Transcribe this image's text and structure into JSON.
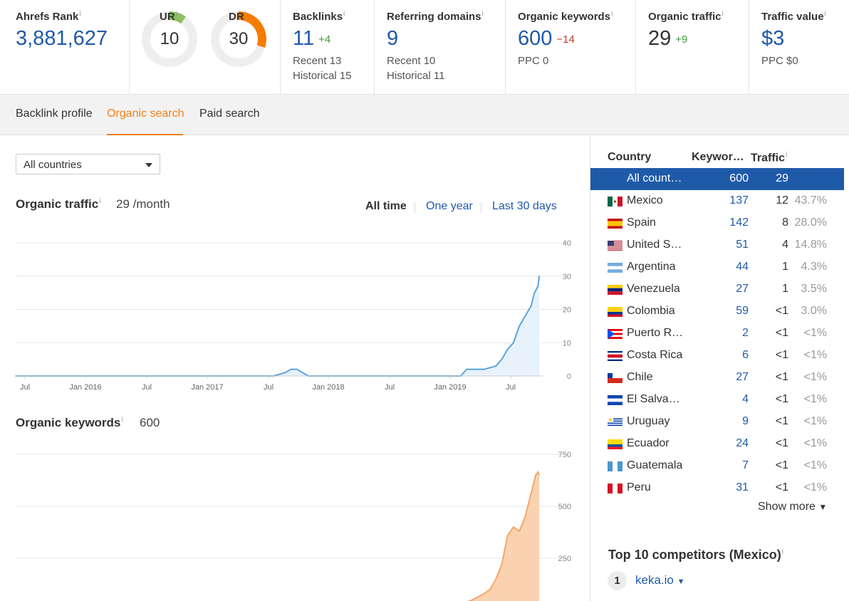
{
  "metrics": {
    "ahrefs_rank": {
      "label": "Ahrefs Rank",
      "value": "3,881,627"
    },
    "ur": {
      "label": "UR",
      "value": "10",
      "level": 0.1
    },
    "dr": {
      "label": "DR",
      "value": "30",
      "level": 0.3
    },
    "backlinks": {
      "label": "Backlinks",
      "value": "11",
      "delta": "+4",
      "recent": "Recent 13",
      "historical": "Historical 15"
    },
    "referring_domains": {
      "label": "Referring domains",
      "value": "9",
      "recent": "Recent 10",
      "historical": "Historical 11"
    },
    "organic_keywords": {
      "label": "Organic keywords",
      "value": "600",
      "delta": "−14",
      "ppc": "PPC 0"
    },
    "organic_traffic": {
      "label": "Organic traffic",
      "value": "29",
      "delta": "+9"
    },
    "traffic_value": {
      "label": "Traffic value",
      "value": "$3",
      "ppc": "PPC $0"
    }
  },
  "info_mark": "i",
  "tabs": {
    "backlink_profile": "Backlink profile",
    "organic_search": "Organic search",
    "paid_search": "Paid search"
  },
  "country_select": "All countries",
  "traffic_section": {
    "title": "Organic traffic",
    "value": "29 /month"
  },
  "time_ranges": {
    "all_time": "All time",
    "one_year": "One year",
    "last_30_days": "Last 30 days"
  },
  "keywords_section": {
    "title": "Organic keywords",
    "value": "600"
  },
  "chart_data": [
    {
      "type": "area",
      "title": "Organic traffic",
      "x_ticks": [
        "Jul",
        "Jan 2016",
        "Jul",
        "Jan 2017",
        "Jul",
        "Jan 2018",
        "Jul",
        "Jan 2019",
        "Jul"
      ],
      "y_ticks": [
        "40",
        "30",
        "20",
        "10",
        "0"
      ],
      "ylim": [
        0,
        40
      ],
      "xlim": [
        2015.5,
        2020.0
      ],
      "color": "#5ba3dc",
      "x": [
        2015.5,
        2017.7,
        2017.8,
        2017.85,
        2017.9,
        2017.95,
        2018.0,
        2018.5,
        2019.3,
        2019.35,
        2019.4,
        2019.5,
        2019.6,
        2019.65,
        2019.7,
        2019.75,
        2019.8,
        2019.85,
        2019.9,
        2019.93,
        2019.96,
        2019.97
      ],
      "values": [
        0,
        0,
        1,
        2,
        2,
        1,
        0,
        0,
        0,
        2,
        2,
        2,
        3,
        5,
        8,
        10,
        15,
        18,
        21,
        25,
        27,
        30
      ]
    },
    {
      "type": "area",
      "title": "Organic keywords",
      "y_ticks": [
        "750",
        "500",
        "250"
      ],
      "ylim": [
        0,
        750
      ],
      "xlim": [
        2015.5,
        2020.0
      ],
      "color": "#f5a56a",
      "x": [
        2017.7,
        2017.8,
        2017.9,
        2017.95,
        2018.0,
        2019.2,
        2019.3,
        2019.4,
        2019.5,
        2019.55,
        2019.6,
        2019.65,
        2019.7,
        2019.75,
        2019.8,
        2019.85,
        2019.9,
        2019.94,
        2019.96,
        2019.97
      ],
      "values": [
        10,
        25,
        30,
        25,
        10,
        10,
        30,
        50,
        80,
        100,
        150,
        220,
        360,
        400,
        380,
        450,
        560,
        650,
        665,
        650
      ]
    }
  ],
  "countries": {
    "headers": {
      "country": "Country",
      "keywords": "Keywor…",
      "traffic": "Traffic"
    },
    "rows": [
      {
        "name": "All count…",
        "kw": "600",
        "tr": "29",
        "pct": "",
        "flag": "none"
      },
      {
        "name": "Mexico",
        "kw": "137",
        "tr": "12",
        "pct": "43.7%",
        "flag": "mexico"
      },
      {
        "name": "Spain",
        "kw": "142",
        "tr": "8",
        "pct": "28.0%",
        "flag": "spain"
      },
      {
        "name": "United S…",
        "kw": "51",
        "tr": "4",
        "pct": "14.8%",
        "flag": "usa"
      },
      {
        "name": "Argentina",
        "kw": "44",
        "tr": "1",
        "pct": "4.3%",
        "flag": "argentina"
      },
      {
        "name": "Venezuela",
        "kw": "27",
        "tr": "1",
        "pct": "3.5%",
        "flag": "venezuela"
      },
      {
        "name": "Colombia",
        "kw": "59",
        "tr": "<1",
        "pct": "3.0%",
        "flag": "colombia"
      },
      {
        "name": "Puerto R…",
        "kw": "2",
        "tr": "<1",
        "pct": "<1%",
        "flag": "puerto-rico"
      },
      {
        "name": "Costa Rica",
        "kw": "6",
        "tr": "<1",
        "pct": "<1%",
        "flag": "costa-rica"
      },
      {
        "name": "Chile",
        "kw": "27",
        "tr": "<1",
        "pct": "<1%",
        "flag": "chile"
      },
      {
        "name": "El Salva…",
        "kw": "4",
        "tr": "<1",
        "pct": "<1%",
        "flag": "el-salvador"
      },
      {
        "name": "Uruguay",
        "kw": "9",
        "tr": "<1",
        "pct": "<1%",
        "flag": "uruguay"
      },
      {
        "name": "Ecuador",
        "kw": "24",
        "tr": "<1",
        "pct": "<1%",
        "flag": "ecuador"
      },
      {
        "name": "Guatemala",
        "kw": "7",
        "tr": "<1",
        "pct": "<1%",
        "flag": "guatemala"
      },
      {
        "name": "Peru",
        "kw": "31",
        "tr": "<1",
        "pct": "<1%",
        "flag": "peru"
      }
    ],
    "show_more": "Show more"
  },
  "competitors": {
    "title": "Top 10 competitors (Mexico)",
    "items": [
      {
        "rank": "1",
        "domain": "keka.io"
      }
    ]
  },
  "colors": {
    "accent": "#f0801a",
    "link": "#1f5aa8",
    "ur_gauge": "#8cc063",
    "dr_gauge": "#f57c00"
  }
}
